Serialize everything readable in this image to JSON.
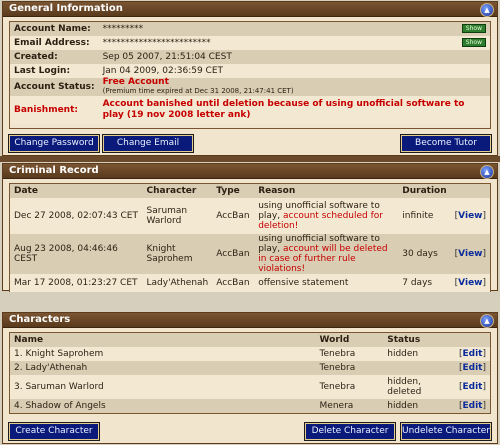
{
  "general": {
    "title": "General Information",
    "collapse_icon": "▲",
    "rows": [
      {
        "label": "Account Name:",
        "value": "*********",
        "show": "Show"
      },
      {
        "label": "Email Address:",
        "value": "************************",
        "show": "Show"
      },
      {
        "label": "Created:",
        "value": "Sep 05 2007, 21:51:04 CEST"
      },
      {
        "label": "Last Login:",
        "value": "Jan 04 2009, 02:36:59 CET"
      },
      {
        "label": "Account Status:",
        "value": "Free Account",
        "sub": "(Premium time expired at Dec 31 2008, 21:47:41 CET)"
      },
      {
        "label": "Banishment:",
        "value": "Account banished until deletion because of using unofficial software to play (19 nov 2008 letter ank)"
      }
    ],
    "buttons": {
      "change_password": "Change Password",
      "change_email": "Change Email",
      "become_tutor": "Become Tutor"
    }
  },
  "criminal": {
    "title": "Criminal Record",
    "collapse_icon": "▲",
    "headers": [
      "Date",
      "Character",
      "Type",
      "Reason",
      "Duration",
      ""
    ],
    "rows": [
      {
        "date": "Dec 27 2008, 02:07:43 CET",
        "character": "Saruman Warlord",
        "type": "AccBan",
        "reason": "using unofficial software to play,",
        "reason_red": "account scheduled for deletion!",
        "duration": "infinite",
        "view": "View"
      },
      {
        "date": "Aug 23 2008, 04:46:46 CEST",
        "character": "Knight Saprohem",
        "type": "AccBan",
        "reason": "using unofficial software to play,",
        "reason_red": "account will be deleted in case of further rule violations!",
        "duration": "30 days",
        "view": "View"
      },
      {
        "date": "Mar 17 2008, 01:23:27 CET",
        "character": "Lady'Athenah",
        "type": "AccBan",
        "reason": "offensive statement",
        "reason_red": "",
        "duration": "7 days",
        "view": "View"
      }
    ]
  },
  "characters": {
    "title": "Characters",
    "collapse_icon": "▲",
    "headers": [
      "Name",
      "World",
      "Status",
      ""
    ],
    "rows": [
      {
        "name": "1. Knight Saprohem",
        "world": "Tenebra",
        "status": "hidden",
        "edit": "Edit"
      },
      {
        "name": "2. Lady'Athenah",
        "world": "Tenebra",
        "status": "",
        "edit": "Edit"
      },
      {
        "name": "3. Saruman Warlord",
        "world": "Tenebra",
        "status": "hidden, deleted",
        "edit": "Edit"
      },
      {
        "name": "4. Shadow of Angels",
        "world": "Menera",
        "status": "hidden",
        "edit": "Edit"
      }
    ],
    "buttons": {
      "create": "Create Character",
      "delete": "Delete Character",
      "undelete": "Undelete Character"
    }
  }
}
